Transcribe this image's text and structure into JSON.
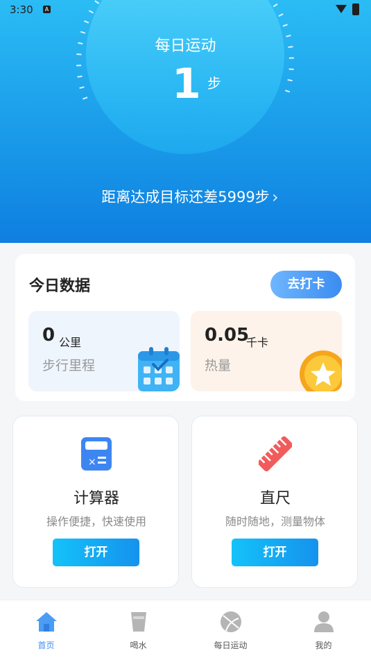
{
  "status_bar": {
    "time": "3:30",
    "indicator": "A"
  },
  "hero": {
    "title": "每日运动",
    "steps": "1",
    "steps_unit": "步",
    "goal_text": "距离达成目标还差5999步",
    "chevron": "›"
  },
  "today": {
    "title": "今日数据",
    "checkin_label": "去打卡",
    "distance": {
      "value": "0",
      "unit": "公里",
      "label": "步行里程",
      "icon": "calendar-icon"
    },
    "calories": {
      "value": "0.05",
      "unit": "千卡",
      "label": "热量",
      "icon": "coin-star-icon"
    }
  },
  "tools": [
    {
      "name": "计算器",
      "desc": "操作便捷，快速使用",
      "button": "打开",
      "icon": "calculator-icon"
    },
    {
      "name": "直尺",
      "desc": "随时随地，测量物体",
      "button": "打开",
      "icon": "ruler-icon"
    }
  ],
  "bottom_nav": [
    {
      "label": "首页",
      "icon": "home-icon",
      "active": true
    },
    {
      "label": "喝水",
      "icon": "cup-icon",
      "active": false
    },
    {
      "label": "每日运动",
      "icon": "ball-icon",
      "active": false
    },
    {
      "label": "我的",
      "icon": "user-icon",
      "active": false
    }
  ],
  "colors": {
    "hero_top": "#2bbcf5",
    "hero_bottom": "#0f7fe0",
    "accent": "#3d8cf0",
    "button_gradient_start": "#14c2f9",
    "button_gradient_end": "#1592ee"
  }
}
